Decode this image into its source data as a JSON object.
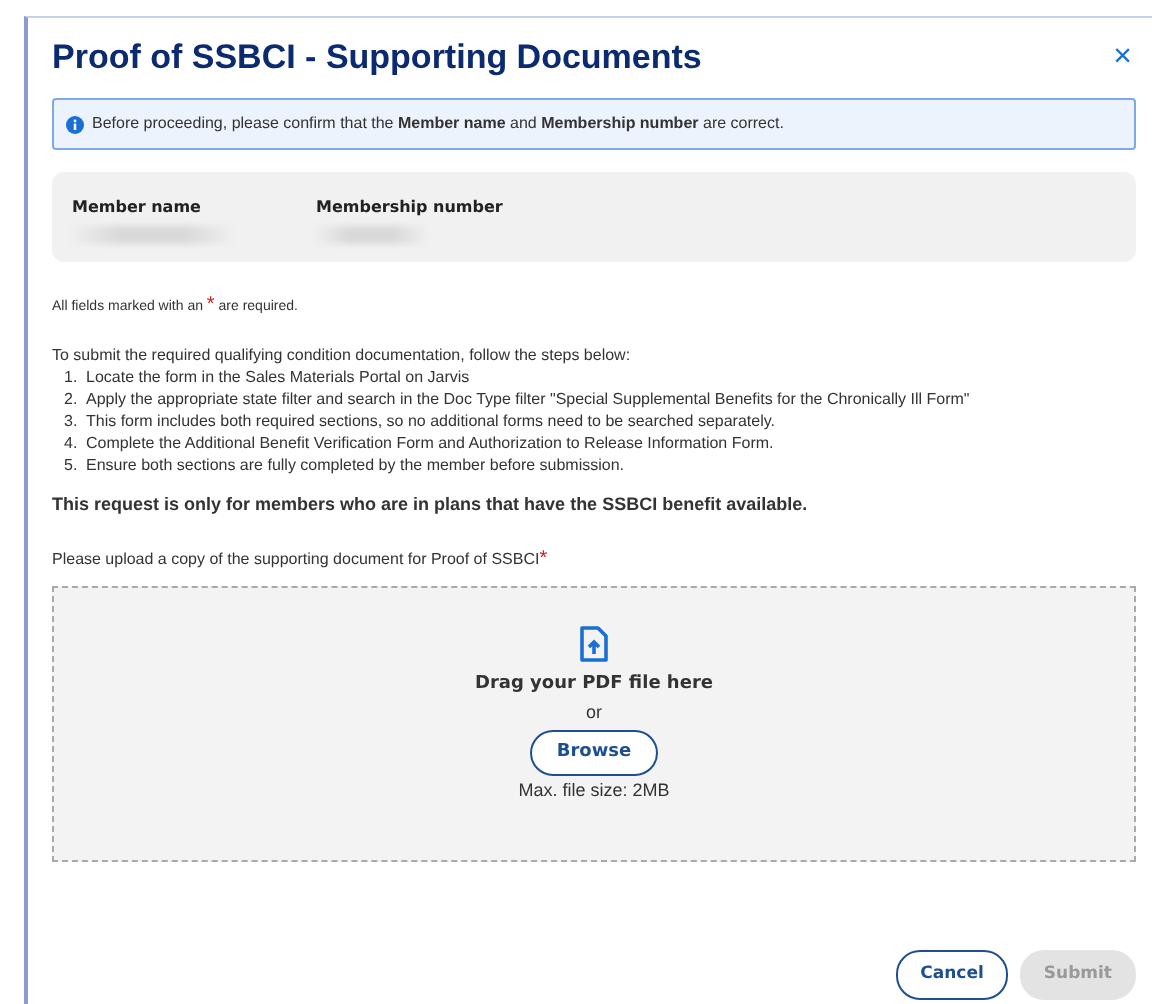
{
  "dialog": {
    "title": "Proof of SSBCI - Supporting Documents",
    "close": "×"
  },
  "alert": {
    "text": "Before proceeding, please confirm that the **Member name** and **Membership number** are correct."
  },
  "member_card": {
    "fields": [
      {
        "label": "Member name"
      },
      {
        "label": "Membership number"
      }
    ]
  },
  "required_note": {
    "before": "All fields marked with an",
    "mark": "*",
    "after": "are required."
  },
  "instructions": {
    "intro": "To submit the required qualifying condition documentation, follow the steps below:",
    "steps": [
      {
        "number": "1.",
        "text": "Locate the form in the Sales Materials Portal on Jarvis"
      },
      {
        "number": "2.",
        "text": "Apply the appropriate state filter and search in the Doc Type filter \"Special Supplemental Benefits for the Chronically Ill Form\""
      },
      {
        "number": "3.",
        "text": "This form includes both required sections, so no additional forms need to be searched separately."
      },
      {
        "number": "4.",
        "text": "Complete the Additional Benefit Verification Form and Authorization to Release Information Form."
      },
      {
        "number": "5.",
        "text": "Ensure both sections are fully completed by the member before submission."
      }
    ]
  },
  "notice": "This request is only for members who are in plans that have the SSBCI benefit available.",
  "upload": {
    "label": "Please upload a copy of the supporting document for Proof of SSBCI",
    "required_mark": "*",
    "drop_text": "Drag your PDF file here",
    "or": "or",
    "browse": "Browse",
    "max_size": "Max. file size: 2MB"
  },
  "buttons": [
    {
      "label": "Cancel",
      "kind": "outline",
      "disabled": false
    },
    {
      "label": "Submit",
      "kind": "primary",
      "disabled": true
    }
  ]
}
